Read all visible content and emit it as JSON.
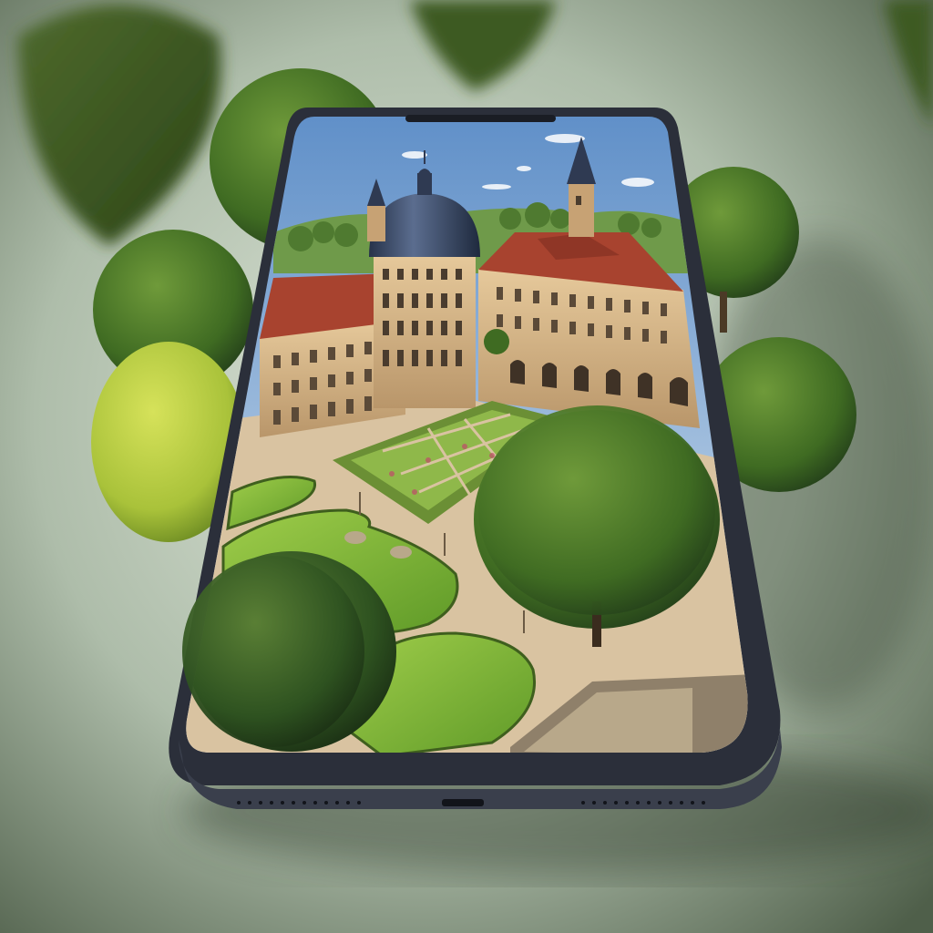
{
  "scene": {
    "subject": "smartphone-with-palace-garden",
    "colors": {
      "background_light": "#c9d6c4",
      "background_dark": "#4f5f4a",
      "sky_top": "#5f8fc8",
      "sky_bottom": "#d9e6f0",
      "phone_frame": "#2b2f3a",
      "roof_red": "#a8432f",
      "dome": "#394863",
      "facade": "#d8b88a",
      "lawn": "#7fb13a",
      "tree_green": "#3f6b22",
      "tree_yellow": "#a9c23a",
      "path": "#d9c3a1"
    }
  }
}
